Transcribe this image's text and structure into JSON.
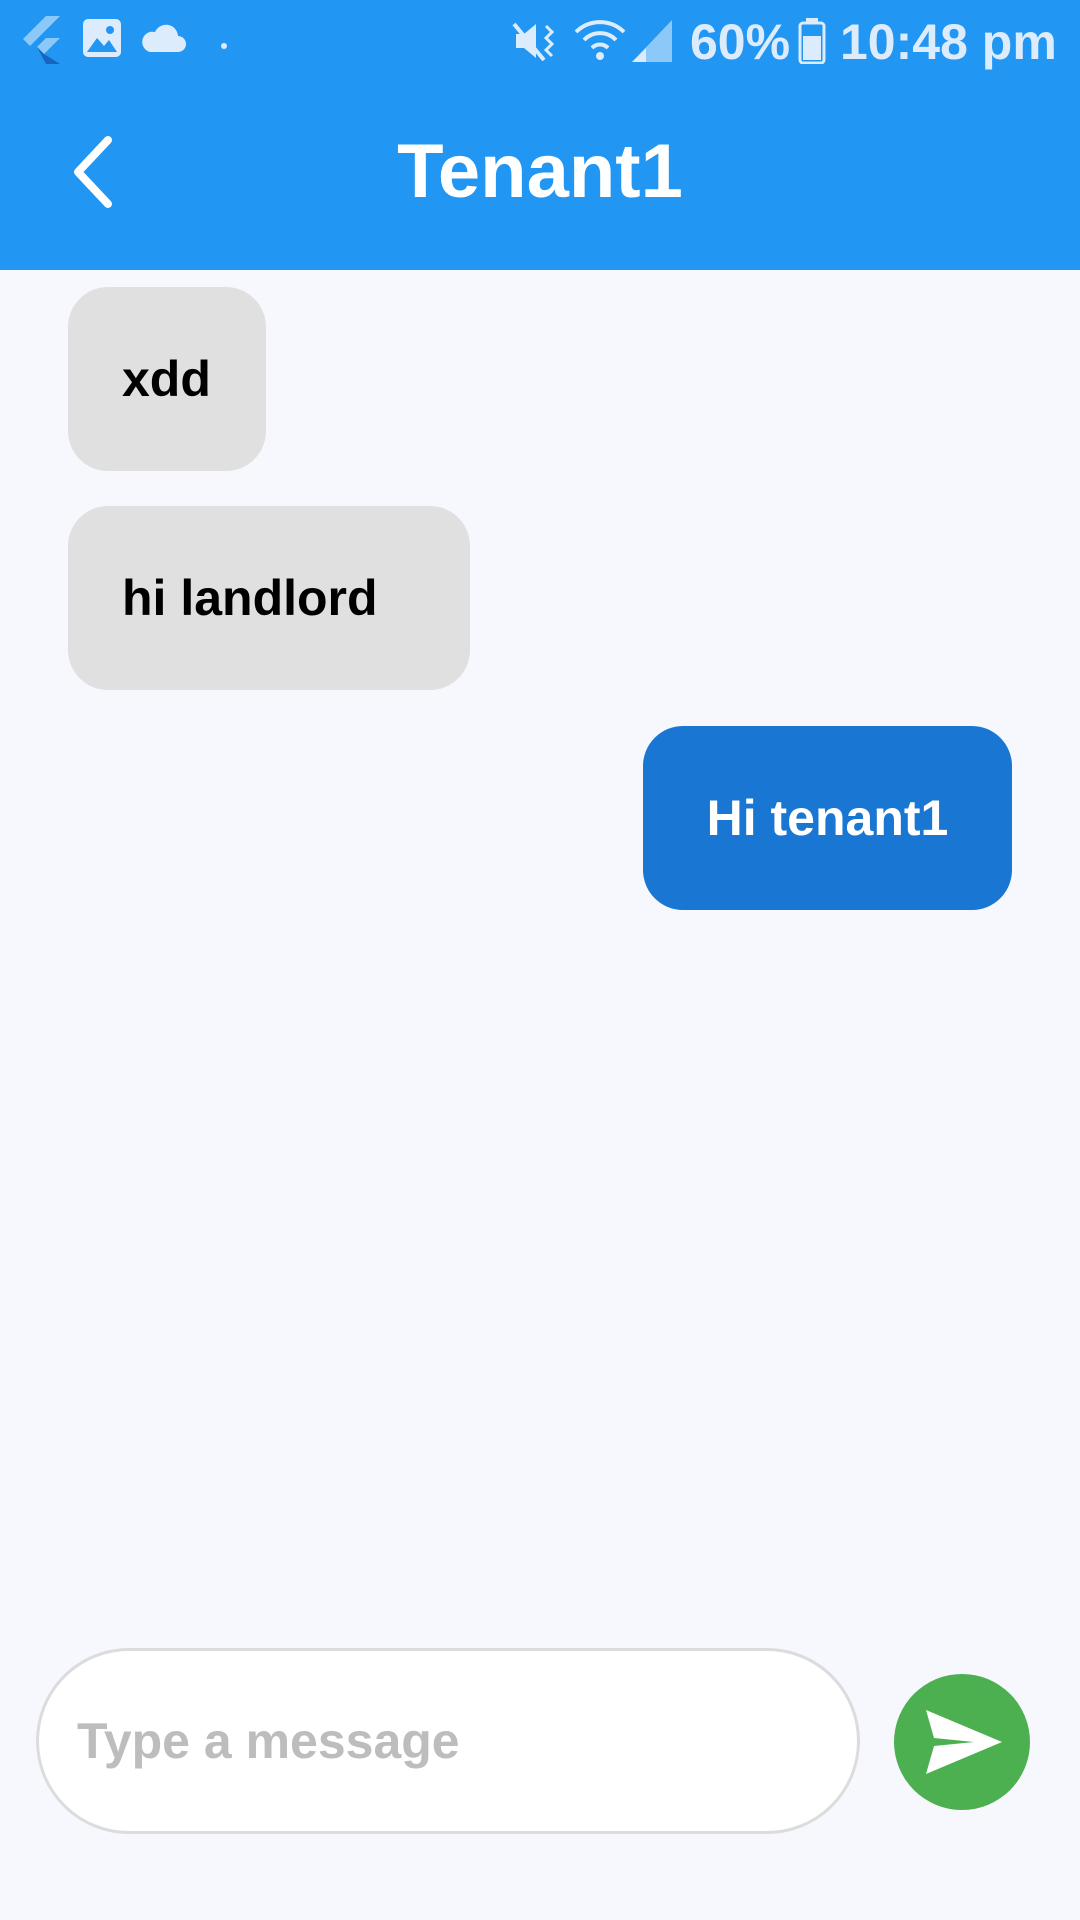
{
  "status_bar": {
    "battery_percent": "60%",
    "time": "10:48 pm",
    "icons": [
      "flutter-icon",
      "image-icon",
      "cloud-icon",
      "dot-icon",
      "mute-vibrate-icon",
      "wifi-icon",
      "signal-icon",
      "battery-icon"
    ]
  },
  "app_bar": {
    "title": "Tenant1",
    "back_icon": "chevron-left-icon"
  },
  "messages": [
    {
      "text": "xdd",
      "direction": "incoming"
    },
    {
      "text": "hi  landlord",
      "direction": "incoming"
    },
    {
      "text": "Hi tenant1",
      "direction": "outgoing"
    }
  ],
  "composer": {
    "value": "",
    "placeholder": "Type a message",
    "send_icon": "send-icon"
  },
  "colors": {
    "app_bar": "#2196f3",
    "background": "#f6f8fd",
    "incoming_bubble": "#e0e0e0",
    "outgoing_bubble": "#1976d2",
    "send_button": "#4caf50"
  }
}
